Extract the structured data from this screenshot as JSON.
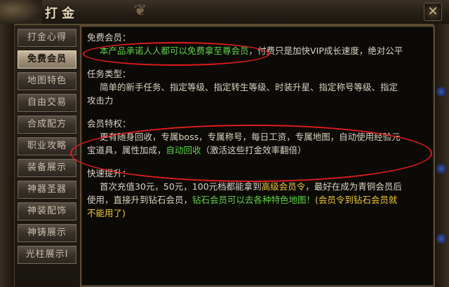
{
  "window": {
    "title": "打金"
  },
  "sidebar": {
    "items": [
      {
        "label": "打金心得",
        "active": false
      },
      {
        "label": "免费会员",
        "active": true
      },
      {
        "label": "地图特色",
        "active": false
      },
      {
        "label": "自由交易",
        "active": false
      },
      {
        "label": "合成配方",
        "active": false
      },
      {
        "label": "职业攻略",
        "active": false
      },
      {
        "label": "装备展示",
        "active": false
      },
      {
        "label": "神器圣器",
        "active": false
      },
      {
        "label": "神装配饰",
        "active": false
      },
      {
        "label": "神铸展示",
        "active": false
      },
      {
        "label": "光柱展示I",
        "active": false
      }
    ]
  },
  "content": {
    "free_member": {
      "heading": "免费会员：",
      "highlight": "本产品承诺人人都可以免费拿至尊会员",
      "rest": "，付费只是加快VIP成长速度，绝对公平"
    },
    "task_type": {
      "heading": "任务类型：",
      "line1": "简单的新手任务、指定等级、指定转生等级、时装升星、指定称号等级、指定",
      "line2": "攻击力"
    },
    "member_privilege": {
      "heading": "会员特权：",
      "line1": "更有随身回收，专属boss，专属称号，每日工资，专属地图，自动使用经验元",
      "line2a": "宝道具，属性加成，",
      "line2_green": "自动回收",
      "line2b": "（激活这些打金效率翻倍）"
    },
    "fast_upgrade": {
      "heading": "快速提升：",
      "line1a": "首次充值30元，50元，100元档都能拿到",
      "line1_yellow": "高级会员令",
      "line1b": "，最好在成为青铜会员后",
      "line2a": "使用，直接升到钻石会员，",
      "line2_green": "钻石会员可以去各种特色地图！",
      "line2_yellow": "(会员令到钻石会员就",
      "line3_yellow": "不能用了)"
    }
  },
  "colors": {
    "highlight_yellow": "#f0c834",
    "highlight_green": "#5fd44a",
    "annotation_red": "#e21c1c"
  }
}
